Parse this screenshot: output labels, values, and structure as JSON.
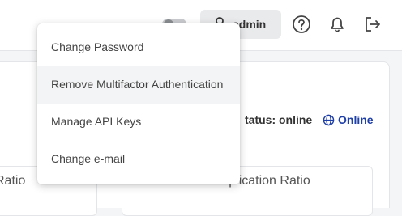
{
  "header": {
    "user_name": "admin",
    "icons": [
      "toggle-switch-icon",
      "user-icon",
      "help-icon",
      "bell-icon",
      "logout-icon"
    ]
  },
  "dropdown_menu": {
    "items": [
      {
        "label": "Change Password"
      },
      {
        "label": "Remove Multifactor Authentication",
        "highlighted": true
      },
      {
        "label": "Manage API Keys"
      },
      {
        "label": "Change e-mail"
      }
    ]
  },
  "status": {
    "label": "tatus: online",
    "link_text": "Online"
  },
  "cards": {
    "left_label": "Ratio",
    "right_label": "Deduplication Ratio"
  },
  "colors": {
    "accent": "#1f3fa8",
    "hover_bg": "#f3f4f5",
    "user_button_bg": "#e9eaec"
  }
}
